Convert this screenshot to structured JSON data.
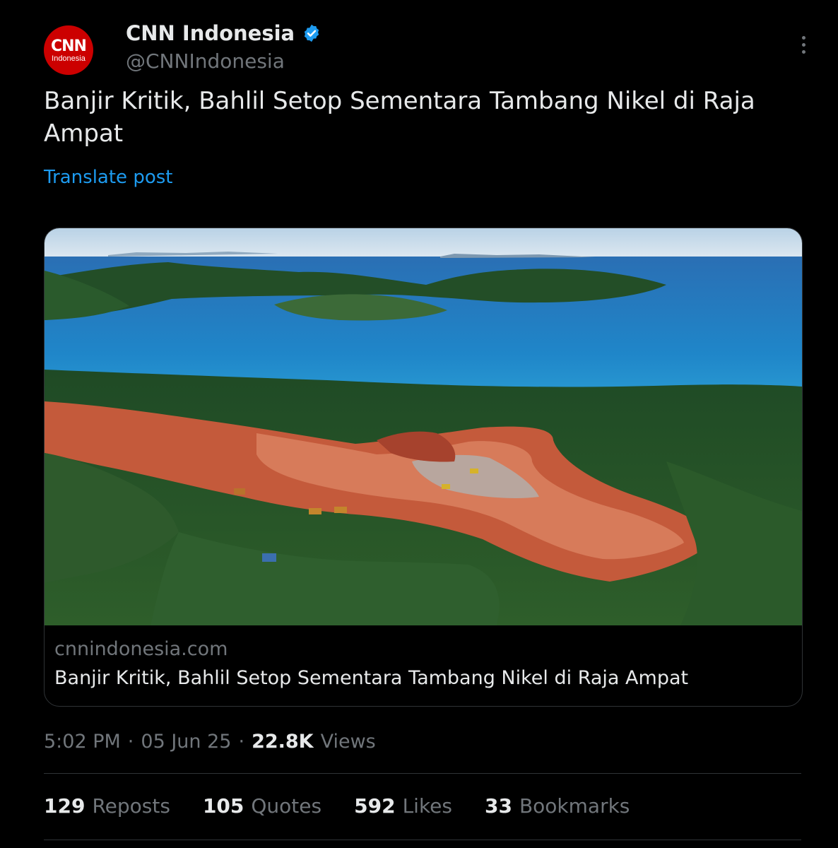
{
  "author": {
    "display_name": "CNN Indonesia",
    "handle": "@CNNIndonesia",
    "logo_main": "CNN",
    "logo_sub": "Indonesia",
    "verified": true,
    "brand_color": "#cc0000"
  },
  "post": {
    "text": "Banjir Kritik, Bahlil Setop Sementara Tambang Nikel di Raja Ampat",
    "translate_label": "Translate post"
  },
  "card": {
    "domain": "cnnindonesia.com",
    "title": "Banjir Kritik, Bahlil Setop Sementara Tambang Nikel di Raja Ampat"
  },
  "meta": {
    "time": "5:02 PM",
    "sep1": "·",
    "date": "05 Jun 25",
    "sep2": "·",
    "views_count": "22.8K",
    "views_label": "Views"
  },
  "stats": [
    {
      "count": "129",
      "label": "Reposts"
    },
    {
      "count": "105",
      "label": "Quotes"
    },
    {
      "count": "592",
      "label": "Likes"
    },
    {
      "count": "33",
      "label": "Bookmarks"
    }
  ],
  "colors": {
    "background": "#000000",
    "text_primary": "#e7e9ea",
    "text_secondary": "#71767b",
    "link": "#1d9bf0",
    "border": "#2f3336"
  },
  "icons": [
    "verified-badge-icon",
    "more-options-icon"
  ]
}
